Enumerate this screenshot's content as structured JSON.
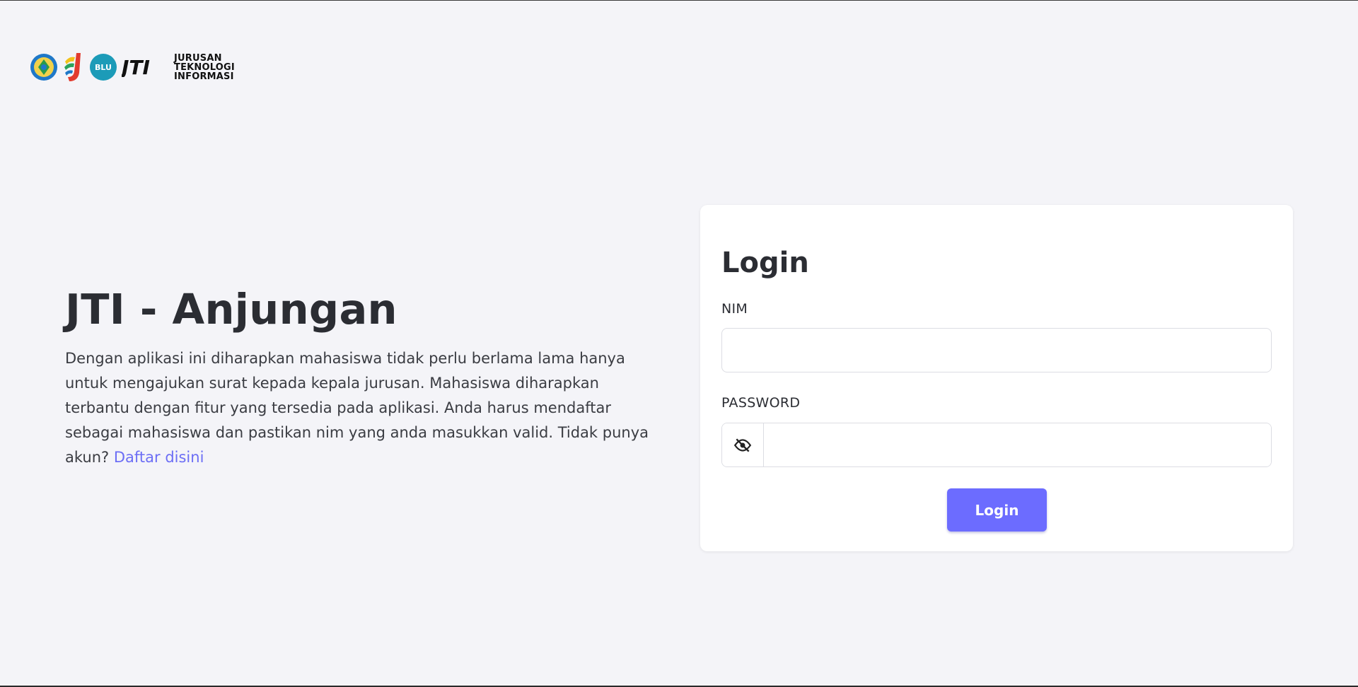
{
  "branding": {
    "logo_line1": "JURUSAN",
    "logo_line2": "TEKNOLOGI",
    "logo_line3": "INFORMASI",
    "jti_mark": "JTI",
    "blu_mark": "BLU"
  },
  "hero": {
    "title": "JTI - Anjungan",
    "description": "Dengan aplikasi ini diharapkan mahasiswa tidak perlu berlama lama hanya untuk mengajukan surat kepada kepala jurusan. Mahasiswa diharapkan terbantu dengan fitur yang tersedia pada aplikasi. Anda harus mendaftar sebagai mahasiswa dan pastikan nim yang anda masukkan valid. Tidak punya akun?",
    "register_link": "Daftar disini"
  },
  "login_form": {
    "title": "Login",
    "nim_label": "NIM",
    "nim_value": "",
    "password_label": "PASSWORD",
    "password_value": "",
    "password_toggle_icon": "eye-slash-icon",
    "submit_label": "Login"
  },
  "colors": {
    "background": "#f4f4f8",
    "card": "#ffffff",
    "accent": "#6c6cff",
    "link": "#6c6ef5",
    "text": "#2b2d33"
  }
}
